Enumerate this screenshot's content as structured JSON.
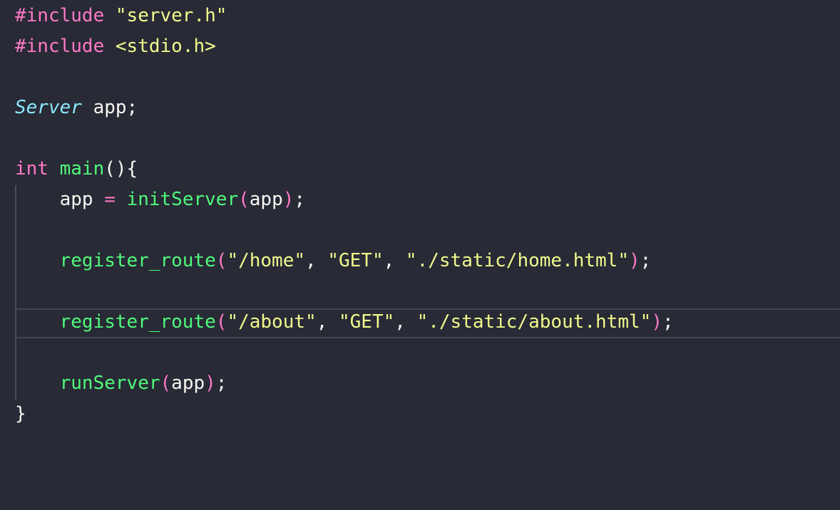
{
  "code": {
    "line1": {
      "directive": "#include",
      "space": " ",
      "header": "\"server.h\""
    },
    "line2": {
      "directive": "#include",
      "space": " ",
      "header": "<stdio.h>"
    },
    "line4": {
      "type": "Server",
      "rest": " app;"
    },
    "line6": {
      "keyword": "int",
      "space": " ",
      "func": "main",
      "parens": "(){"
    },
    "line7": {
      "indent": "    ",
      "var": "app",
      "space1": " ",
      "op": "=",
      "space2": " ",
      "func": "initServer",
      "lparen": "(",
      "arg": "app",
      "rparen": ")",
      "semi": ";"
    },
    "line9": {
      "indent": "    ",
      "func": "register_route",
      "lparen": "(",
      "arg1": "\"/home\"",
      "sep1": ", ",
      "arg2": "\"GET\"",
      "sep2": ", ",
      "arg3": "\"./static/home.html\"",
      "rparen": ")",
      "semi": ";"
    },
    "line11": {
      "indent": "    ",
      "func": "register_route",
      "lparen": "(",
      "arg1": "\"/about\"",
      "sep1": ", ",
      "arg2": "\"GET\"",
      "sep2": ", ",
      "arg3": "\"./static/about.html\"",
      "rparen": ")",
      "semi": ";"
    },
    "line13": {
      "indent": "    ",
      "func": "runServer",
      "lparen": "(",
      "arg": "app",
      "rparen": ")",
      "semi": ";"
    },
    "line14": {
      "brace": "}"
    }
  },
  "colors": {
    "background": "#282a36",
    "keyword": "#ff79c6",
    "string": "#f1fa8c",
    "type": "#8be9fd",
    "function": "#50fa7b",
    "foreground": "#f8f8f2"
  }
}
